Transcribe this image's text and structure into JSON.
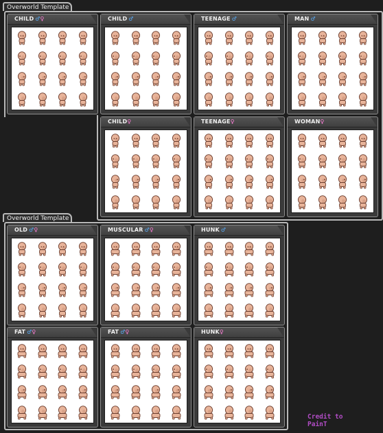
{
  "sheets": [
    {
      "title": "Overworld Template"
    },
    {
      "title": "Overworld Template"
    }
  ],
  "panels": [
    {
      "label": "CHILD",
      "gender": [
        "male",
        "female"
      ]
    },
    {
      "label": "CHILD",
      "gender": [
        "male"
      ]
    },
    {
      "label": "TEENAGE",
      "gender": [
        "male"
      ]
    },
    {
      "label": "MAN",
      "gender": [
        "male"
      ]
    },
    {
      "label": "CHILD",
      "gender": [
        "female"
      ]
    },
    {
      "label": "TEENAGE",
      "gender": [
        "female"
      ]
    },
    {
      "label": "WOMAN",
      "gender": [
        "female"
      ]
    },
    {
      "label": "OLD",
      "gender": [
        "male",
        "female"
      ]
    },
    {
      "label": "MUSCULAR",
      "gender": [
        "male",
        "female"
      ]
    },
    {
      "label": "HUNK",
      "gender": [
        "male"
      ]
    },
    {
      "label": "FAT",
      "gender": [
        "male",
        "female"
      ]
    },
    {
      "label": "FAT",
      "gender": [
        "male",
        "female"
      ]
    },
    {
      "label": "HUNK",
      "gender": [
        "female"
      ]
    }
  ],
  "sprite_grid": {
    "rows": 4,
    "columns": 4,
    "directions": [
      "down",
      "left",
      "right",
      "up"
    ]
  },
  "credit": {
    "line1": "Credit to",
    "line2": "PainT"
  },
  "colors": {
    "background": "#1e1e1e",
    "skin": "#e8b49a",
    "skin_shadow": "#c98e75",
    "outline": "#6b3d2e",
    "male_symbol": "#5ab0ff",
    "female_symbol": "#ff7fd9",
    "credit": "#b04cc4"
  }
}
